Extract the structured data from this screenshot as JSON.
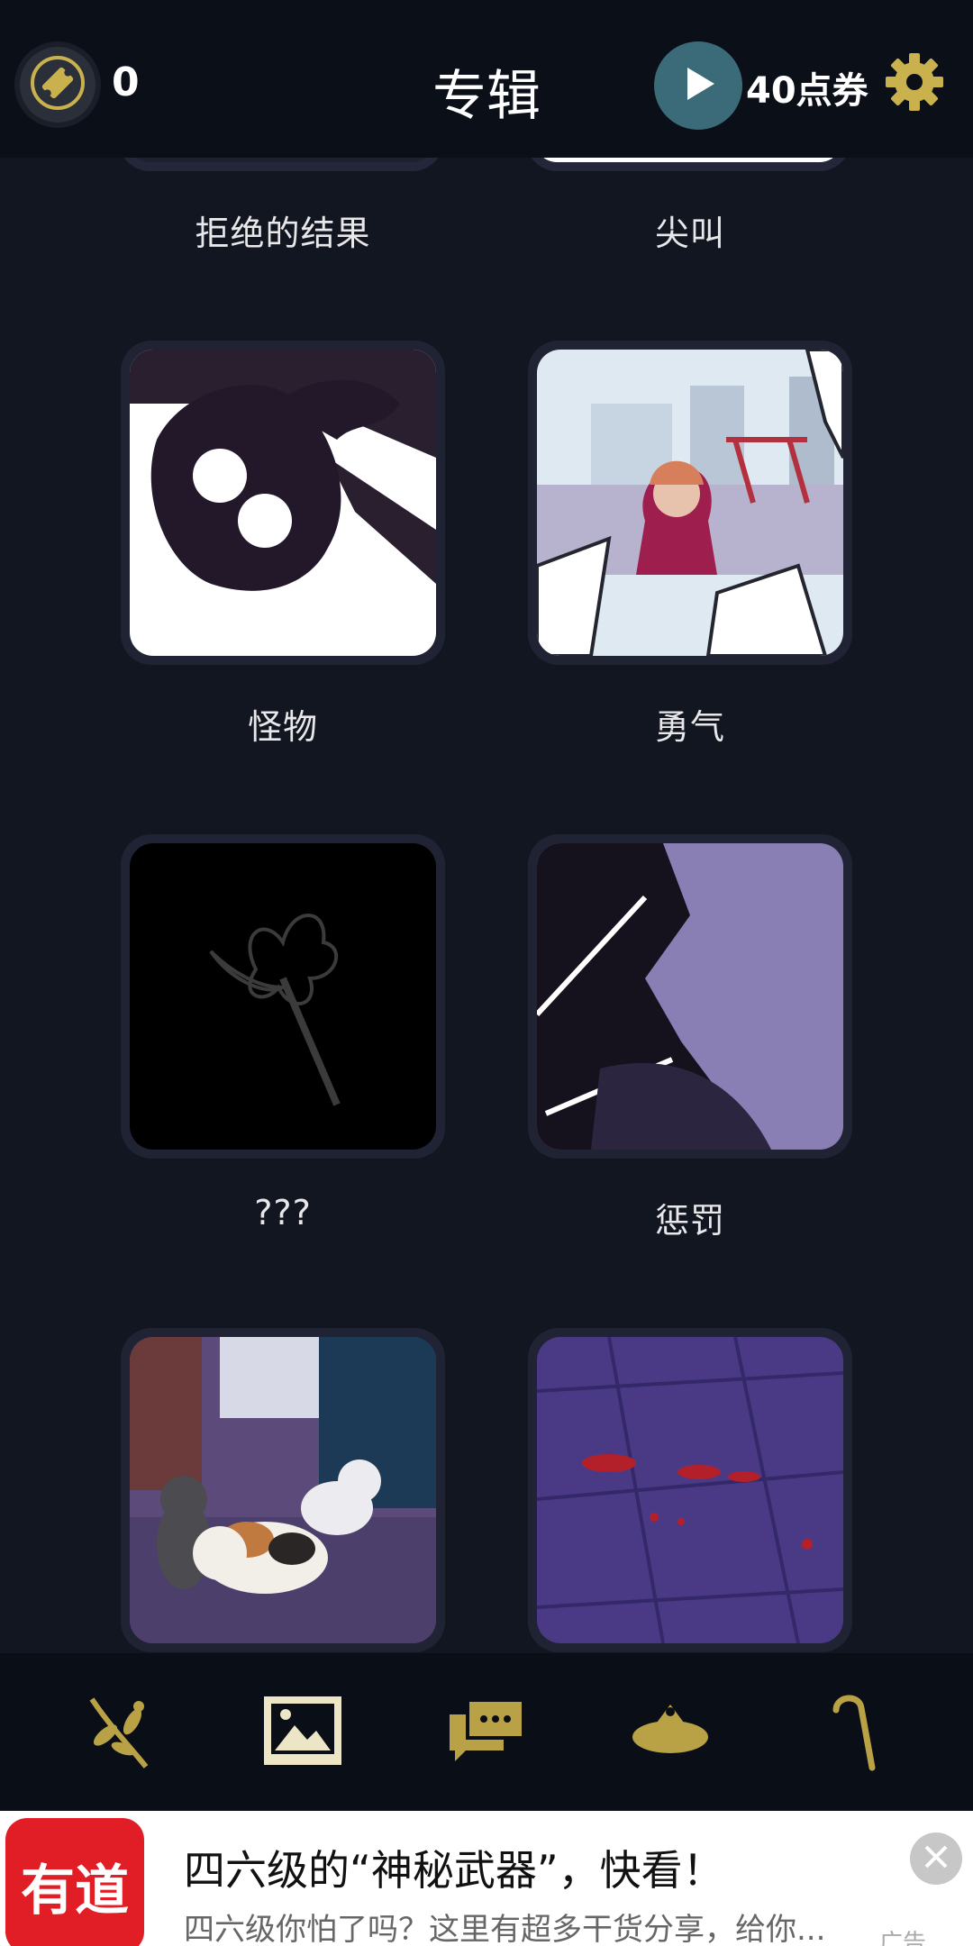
{
  "header": {
    "title": "专辑",
    "ticket_count": "0",
    "coupon_label": "40点券",
    "ticket_icon": "ticket-icon",
    "play_icon": "play-icon",
    "settings_icon": "gear-icon"
  },
  "albums": [
    {
      "label": "拒绝的结果"
    },
    {
      "label": "尖叫"
    },
    {
      "label": "怪物"
    },
    {
      "label": "勇气"
    },
    {
      "label": "???"
    },
    {
      "label": "惩罚"
    },
    {
      "label": ""
    },
    {
      "label": ""
    }
  ],
  "bottom_nav": {
    "items": [
      {
        "icon": "sprig-icon"
      },
      {
        "icon": "gallery-icon"
      },
      {
        "icon": "chat-icon"
      },
      {
        "icon": "hat-icon"
      },
      {
        "icon": "cane-icon"
      }
    ],
    "active_index": 1
  },
  "ad": {
    "logo_text": "有道",
    "title": "四六级的“神秘武器”，快看！",
    "description": "四六级你怕了吗？这里有超多干货分享，给你...",
    "tag": "广告"
  },
  "colors": {
    "accent_gold": "#c9b24e",
    "background": "#121620",
    "play_teal": "#3b6b78",
    "ad_red": "#e11d25"
  }
}
